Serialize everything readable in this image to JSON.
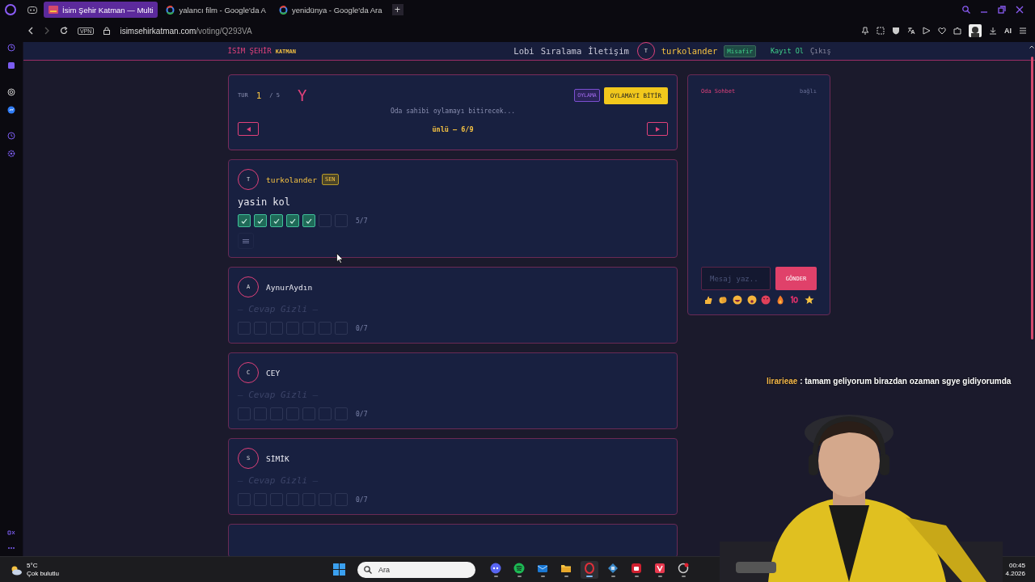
{
  "browser": {
    "tabs": [
      {
        "label": "İsim Şehir Katman — Multi",
        "selected": true,
        "kind": "site"
      },
      {
        "label": "yalancı film - Google'da A",
        "selected": false,
        "kind": "search"
      },
      {
        "label": "yenidünya - Google'da Ara",
        "selected": false,
        "kind": "search"
      }
    ],
    "new_tab": "+",
    "vpn": "VPN",
    "url": {
      "domain": "isimsehirkatman.com",
      "path": "/voting/Q293VA"
    },
    "ai_button": "AI"
  },
  "header": {
    "logo": {
      "primary": "İSİM ŞEHİR",
      "secondary": "KATMAN"
    },
    "nav": [
      "Lobi",
      "Sıralama",
      "İletişim"
    ],
    "user": {
      "initial": "T",
      "name": "turkolander",
      "badge": "Misafir"
    },
    "register": "Kayıt Ol",
    "logout": "Çıkış"
  },
  "round": {
    "label": "TUR",
    "current": "1",
    "total": "/ 5",
    "letter": "Y",
    "phase": "OYLAMA",
    "finish_button": "OYLAMAYI BİTİR",
    "status": "Oda sahibi oylamayı bitirecek...",
    "category": "ünlü — 6/9"
  },
  "players": [
    {
      "initial": "T",
      "name": "turkolander",
      "you": true,
      "you_badge": "SEN",
      "answer": "yasin kol",
      "hidden": false,
      "votes": [
        true,
        true,
        true,
        true,
        true,
        false,
        false
      ],
      "count": "5/7",
      "has_menu": true
    },
    {
      "initial": "A",
      "name": "AynurAydın",
      "you": false,
      "answer": "— Cevap Gizli —",
      "hidden": true,
      "votes": [
        false,
        false,
        false,
        false,
        false,
        false,
        false
      ],
      "count": "0/7",
      "has_menu": false
    },
    {
      "initial": "C",
      "name": "CEY",
      "you": false,
      "answer": "— Cevap Gizli —",
      "hidden": true,
      "votes": [
        false,
        false,
        false,
        false,
        false,
        false,
        false
      ],
      "count": "0/7",
      "has_menu": false
    },
    {
      "initial": "S",
      "name": "SİMİK",
      "you": false,
      "answer": "— Cevap Gizli —",
      "hidden": true,
      "votes": [
        false,
        false,
        false,
        false,
        false,
        false,
        false
      ],
      "count": "0/7",
      "has_menu": false
    }
  ],
  "more_cards_below": true,
  "chat": {
    "title": "Oda Sohbet",
    "status": "bağlı",
    "placeholder": "Mesaj yaz..",
    "send": "GÖNDER",
    "reactions": [
      {
        "kind": "thumb"
      },
      {
        "kind": "clap"
      },
      {
        "kind": "laugh"
      },
      {
        "kind": "wow"
      },
      {
        "kind": "angry"
      },
      {
        "kind": "fire"
      },
      {
        "kind": "hundred"
      },
      {
        "kind": "star"
      }
    ]
  },
  "stream_chat": {
    "user": "lirarieae",
    "message": ": tamam geliyorum birazdan ozaman sgye gidiyorumda"
  },
  "taskbar": {
    "temperature": "5°C",
    "weather": "Çok bulutlu",
    "search_placeholder": "Ara",
    "time": "00:45",
    "date": "4.2026",
    "apps": [
      {
        "kind": "chat",
        "active": false
      },
      {
        "kind": "music",
        "active": false
      },
      {
        "kind": "mail",
        "active": false
      },
      {
        "kind": "folder",
        "active": false
      },
      {
        "kind": "browser",
        "active": true
      },
      {
        "kind": "tool",
        "active": false
      },
      {
        "kind": "game",
        "active": false
      },
      {
        "kind": "red",
        "active": false
      },
      {
        "kind": "dial",
        "active": false
      }
    ]
  }
}
